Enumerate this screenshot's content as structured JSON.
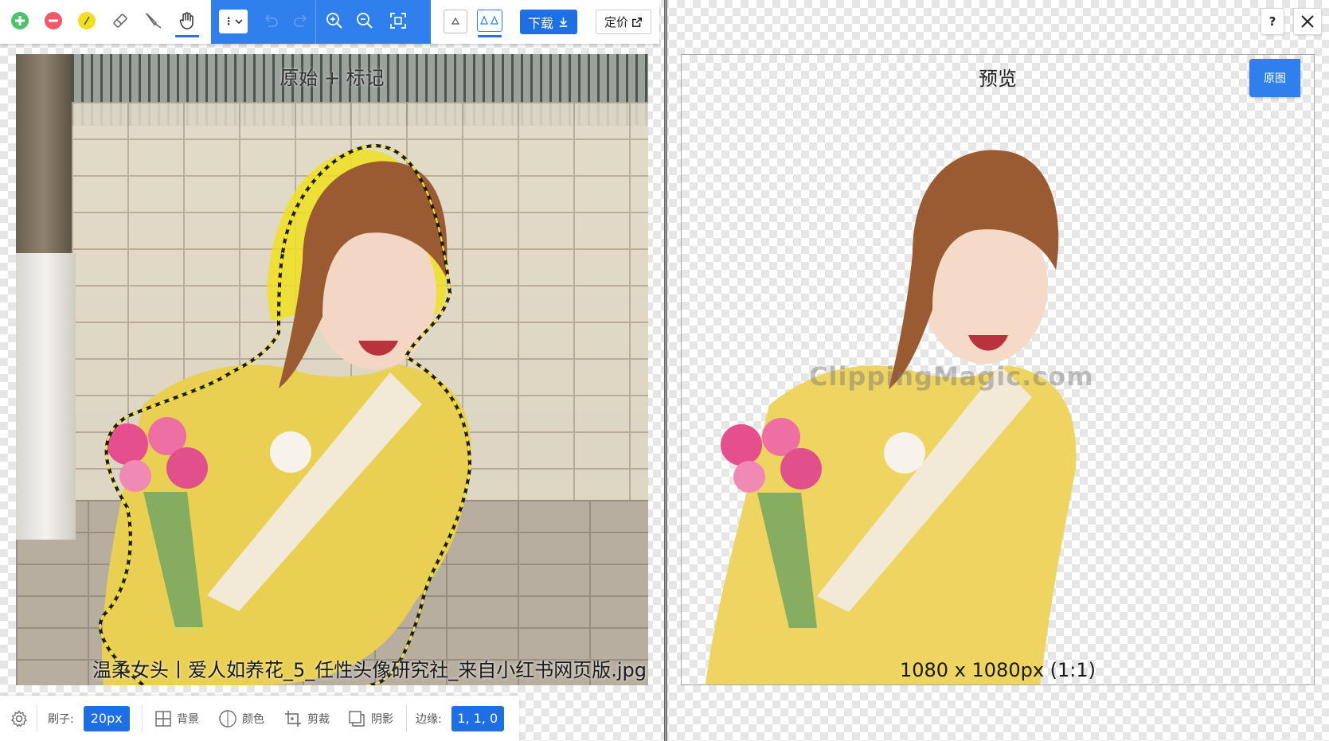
{
  "toolbar": {
    "mini_select": "⋮",
    "download_label": "下载",
    "price_label": "定价"
  },
  "window_buttons": {
    "help": "?"
  },
  "left_panel": {
    "title": "原始 + 标记",
    "filename": "温柔女头丨爱人如养花_5_任性头像研究社_来自小红书网页版.jpg"
  },
  "right_panel": {
    "title": "预览",
    "watermark": "ClippingMagic.com",
    "dimensions": "1080 x 1080px (1:1)",
    "original_button": "原图"
  },
  "bottombar": {
    "brush_label": "刷子:",
    "brush_value": "20px",
    "background_label": "背景",
    "color_label": "颜色",
    "crop_label": "剪裁",
    "shadow_label": "阴影",
    "edge_label": "边缘:",
    "edge_value": "1, 1, 0"
  },
  "colors": {
    "accent": "#2f80ed",
    "keep_green": "#4cc36a",
    "remove_red": "#ee5a6a",
    "hair_yellow": "#f0e020"
  }
}
